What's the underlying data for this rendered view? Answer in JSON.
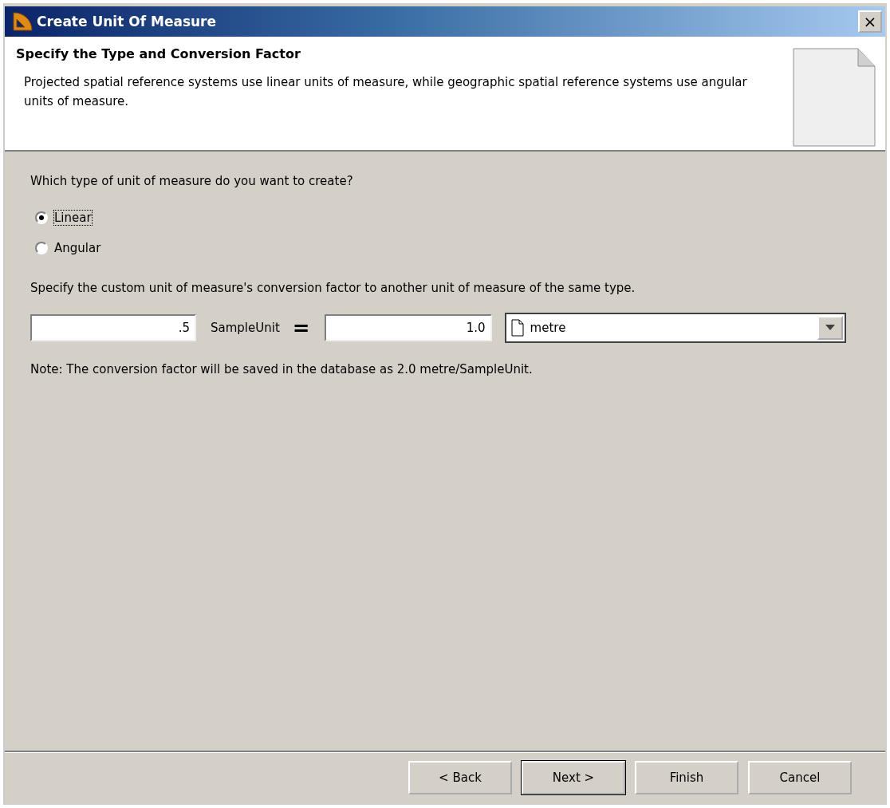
{
  "window": {
    "title": "Create Unit Of Measure",
    "close": "×"
  },
  "header": {
    "title": "Specify the Type and Conversion Factor",
    "description": "Projected spatial reference systems use linear units of measure, while geographic spatial reference systems use angular units of measure."
  },
  "question": "Which type of unit of measure do you want to create?",
  "unit_types": [
    {
      "label": "Linear",
      "selected": true
    },
    {
      "label": "Angular",
      "selected": false
    }
  ],
  "conversion_prompt": "Specify the custom unit of measure's conversion factor to another unit of measure of the same type.",
  "conversion": {
    "custom_value": ".5",
    "custom_unit": "SampleUnit",
    "equals": "=",
    "reference_value": "1.0",
    "reference_unit": "metre"
  },
  "note": "Note: The conversion factor will be saved in the database as 2.0 metre/SampleUnit.",
  "buttons": [
    {
      "label": "< Back",
      "default": false
    },
    {
      "label": "Next >",
      "default": true
    },
    {
      "label": "Finish",
      "default": false
    },
    {
      "label": "Cancel",
      "default": false
    }
  ]
}
